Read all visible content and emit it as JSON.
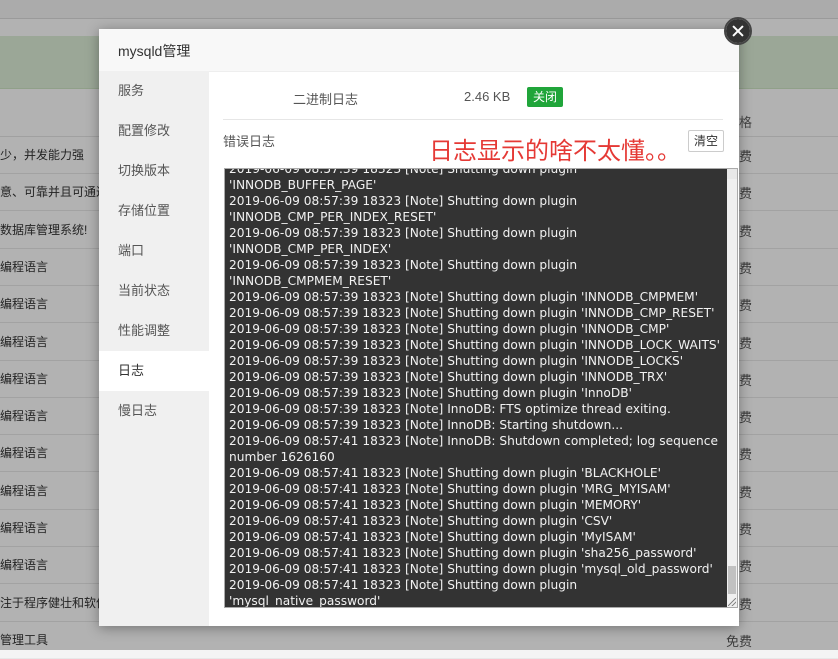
{
  "background": {
    "header_price": "价格",
    "rows": [
      {
        "text": "少，并发能力强",
        "price": "免费"
      },
      {
        "text": "意、可靠并且可通过",
        "price": "免费"
      },
      {
        "text": "数据库管理系统!",
        "price": "免费"
      },
      {
        "text": "编程语言",
        "price": "免费"
      },
      {
        "text": "编程语言",
        "price": "免费"
      },
      {
        "text": "编程语言",
        "price": "免费"
      },
      {
        "text": "编程语言",
        "price": "免费"
      },
      {
        "text": "编程语言",
        "price": "免费"
      },
      {
        "text": "编程语言",
        "price": "免费"
      },
      {
        "text": "编程语言",
        "price": "免费"
      },
      {
        "text": "编程语言",
        "price": "免费"
      },
      {
        "text": "编程语言",
        "price": "免费"
      },
      {
        "text": "注于程序健壮和软件",
        "price": "免费"
      },
      {
        "text": "管理工具",
        "price": "免费"
      }
    ]
  },
  "dialog": {
    "title": "mysqld管理",
    "sidebar": [
      {
        "label": "服务"
      },
      {
        "label": "配置修改"
      },
      {
        "label": "切换版本"
      },
      {
        "label": "存储位置"
      },
      {
        "label": "端口"
      },
      {
        "label": "当前状态"
      },
      {
        "label": "性能调整"
      },
      {
        "label": "日志",
        "active": true
      },
      {
        "label": "慢日志"
      }
    ],
    "binlog": {
      "label": "二进制日志",
      "size": "2.46 KB",
      "toggle": "关闭"
    },
    "errlog": {
      "label": "错误日志",
      "clear": "清空"
    },
    "annotation": "日志显示的啥不太懂。。",
    "log_text": "2019-06-09 08:57:39 18323 [Note] Shutting down plugin 'INNODB_BUFFER_PAGE'\n2019-06-09 08:57:39 18323 [Note] Shutting down plugin 'INNODB_CMP_PER_INDEX_RESET'\n2019-06-09 08:57:39 18323 [Note] Shutting down plugin 'INNODB_CMP_PER_INDEX'\n2019-06-09 08:57:39 18323 [Note] Shutting down plugin 'INNODB_CMPMEM_RESET'\n2019-06-09 08:57:39 18323 [Note] Shutting down plugin 'INNODB_CMPMEM'\n2019-06-09 08:57:39 18323 [Note] Shutting down plugin 'INNODB_CMP_RESET'\n2019-06-09 08:57:39 18323 [Note] Shutting down plugin 'INNODB_CMP'\n2019-06-09 08:57:39 18323 [Note] Shutting down plugin 'INNODB_LOCK_WAITS'\n2019-06-09 08:57:39 18323 [Note] Shutting down plugin 'INNODB_LOCKS'\n2019-06-09 08:57:39 18323 [Note] Shutting down plugin 'INNODB_TRX'\n2019-06-09 08:57:39 18323 [Note] Shutting down plugin 'InnoDB'\n2019-06-09 08:57:39 18323 [Note] InnoDB: FTS optimize thread exiting.\n2019-06-09 08:57:39 18323 [Note] InnoDB: Starting shutdown...\n2019-06-09 08:57:41 18323 [Note] InnoDB: Shutdown completed; log sequence number 1626160\n2019-06-09 08:57:41 18323 [Note] Shutting down plugin 'BLACKHOLE'\n2019-06-09 08:57:41 18323 [Note] Shutting down plugin 'MRG_MYISAM'\n2019-06-09 08:57:41 18323 [Note] Shutting down plugin 'MEMORY'\n2019-06-09 08:57:41 18323 [Note] Shutting down plugin 'CSV'\n2019-06-09 08:57:41 18323 [Note] Shutting down plugin 'MyISAM'\n2019-06-09 08:57:41 18323 [Note] Shutting down plugin 'sha256_password'\n2019-06-09 08:57:41 18323 [Note] Shutting down plugin 'mysql_old_password'\n2019-06-09 08:57:41 18323 [Note] Shutting down plugin 'mysql_native_password'\n2019-06-09 08:57:41 18323 [Note] Shutting down plugin 'binlog'\n2019-06-09 08:57:41 18323 [Note] /www/server/mysql/bin/mysqld: Shutdown complete"
  },
  "colors": {
    "accent": "#20a53a",
    "annotation": "#e53935",
    "log_bg": "#333333"
  }
}
